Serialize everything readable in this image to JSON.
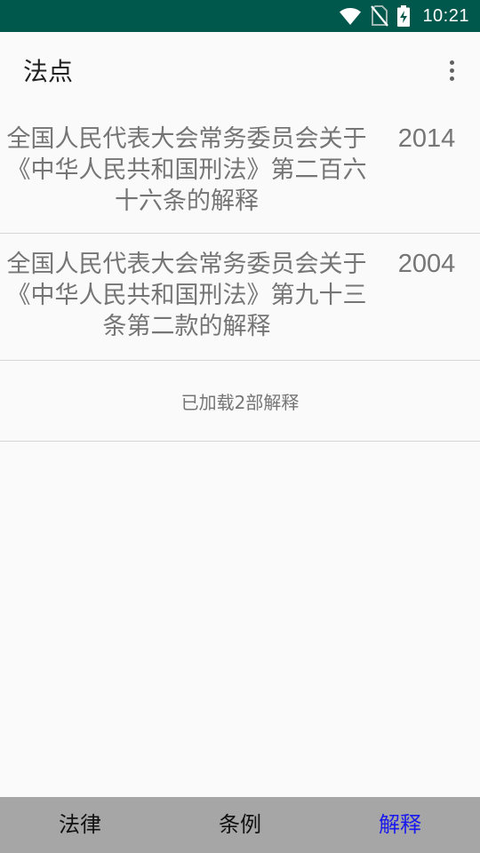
{
  "status_bar": {
    "time": "10:21",
    "icons": [
      "wifi-icon",
      "no-sim-icon",
      "battery-charging-icon"
    ],
    "background": "#00574b"
  },
  "app_bar": {
    "title": "法点",
    "overflow_icon": "more-vert-icon"
  },
  "list": {
    "items": [
      {
        "title": "全国人民代表大会常务委员会关于《中华人民共和国刑法》第二百六十六条的解释",
        "year": "2014"
      },
      {
        "title": "全国人民代表大会常务委员会关于《中华人民共和国刑法》第九十三条第二款的解释",
        "year": "2004"
      }
    ],
    "footer_status": "已加载2部解释"
  },
  "bottom_nav": {
    "tabs": [
      {
        "label": "法律"
      },
      {
        "label": "条例"
      },
      {
        "label": "解释"
      }
    ],
    "active_tab": "解释",
    "active_color": "#1a1aee",
    "background": "#a6a6a6"
  }
}
